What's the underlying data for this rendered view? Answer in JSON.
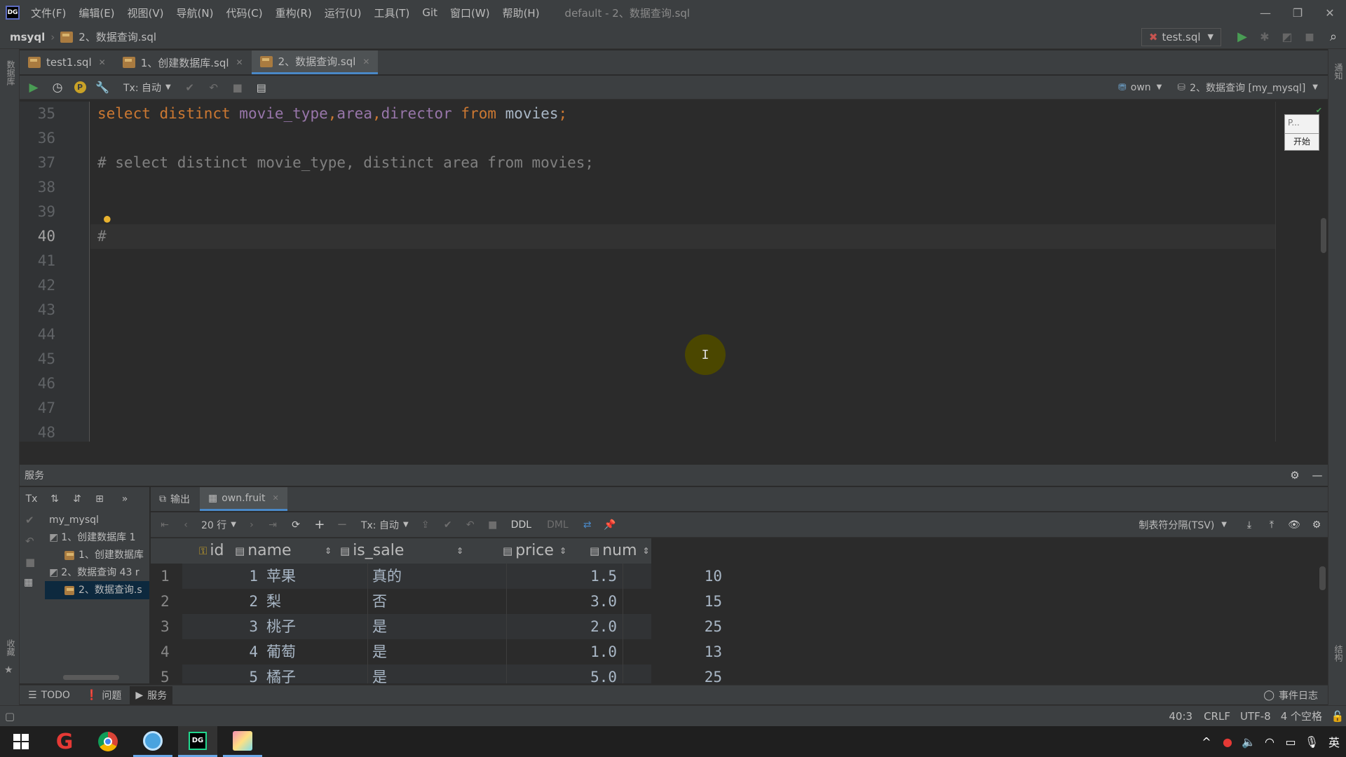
{
  "menu": {
    "items": [
      "文件(F)",
      "编辑(E)",
      "视图(V)",
      "导航(N)",
      "代码(C)",
      "重构(R)",
      "运行(U)",
      "工具(T)",
      "Git",
      "窗口(W)",
      "帮助(H)"
    ],
    "window_title": "default - 2、数据查询.sql"
  },
  "navbar": {
    "project": "msyql",
    "file": "2、数据查询.sql",
    "run_config": "test.sql"
  },
  "tabs": [
    {
      "label": "test1.sql"
    },
    {
      "label": "1、创建数据库.sql"
    },
    {
      "label": "2、数据查询.sql"
    }
  ],
  "toolbar": {
    "tx_mode": "Tx: 自动",
    "schema": "own",
    "console": "2、数据查询 [my_mysql]"
  },
  "editor": {
    "line_numbers": [
      "35",
      "36",
      "37",
      "38",
      "39",
      "40",
      "41",
      "42",
      "43",
      "44",
      "45",
      "46",
      "47",
      "48"
    ],
    "current_line": "40",
    "lines": {
      "l35": {
        "kw1": "select distinct ",
        "f1": "movie_type",
        "p1": ",",
        "f2": "area",
        "p2": ",",
        "f3": "director",
        "kw2": " from ",
        "t": "movies",
        "semi": ";"
      },
      "l37": "# select distinct movie_type, distinct area from movies;",
      "l40": "#"
    },
    "mini_panel": {
      "label": "P...",
      "start_button": "开始"
    }
  },
  "services": {
    "title": "服务",
    "tree": {
      "root": "my_mysql",
      "items": [
        "1、创建数据库 1",
        "1、创建数据库",
        "2、数据查询 43 r",
        "2、数据查询.s"
      ]
    },
    "tabs": [
      {
        "label": "输出"
      },
      {
        "label": "own.fruit"
      }
    ],
    "grid_toolbar": {
      "rows": "20 行",
      "tx_mode": "Tx: 自动",
      "ddl": "DDL",
      "dml": "DML",
      "format": "制表符分隔(TSV)"
    },
    "grid": {
      "columns": [
        "id",
        "name",
        "is_sale",
        "price",
        "num"
      ],
      "rows": [
        {
          "idx": "1",
          "id": "1",
          "name": "苹果",
          "is_sale": "真的",
          "price": "1.5",
          "num": "10"
        },
        {
          "idx": "2",
          "id": "2",
          "name": "梨",
          "is_sale": "否",
          "price": "3.0",
          "num": "15"
        },
        {
          "idx": "3",
          "id": "3",
          "name": "桃子",
          "is_sale": "是",
          "price": "2.0",
          "num": "25"
        },
        {
          "idx": "4",
          "id": "4",
          "name": "葡萄",
          "is_sale": "是",
          "price": "1.0",
          "num": "13"
        },
        {
          "idx": "5",
          "id": "5",
          "name": "橘子",
          "is_sale": "是",
          "price": "5.0",
          "num": "25"
        }
      ]
    }
  },
  "toolwindows": {
    "todo": "TODO",
    "problems": "问题",
    "services": "服务",
    "event_log": "事件日志"
  },
  "statusbar": {
    "position": "40:3",
    "line_sep": "CRLF",
    "encoding": "UTF-8",
    "indent": "4 个空格"
  },
  "taskbar": {
    "ime": "英"
  },
  "side_labels": {
    "left_top": "数据库",
    "left_bottom": "收藏",
    "right_top": "通知",
    "right_bottom": "结构"
  },
  "colors": {
    "keyword": "#cc7832",
    "field": "#9876aa",
    "comment": "#808080",
    "accent": "#4a88c7",
    "run_green": "#499c54"
  }
}
